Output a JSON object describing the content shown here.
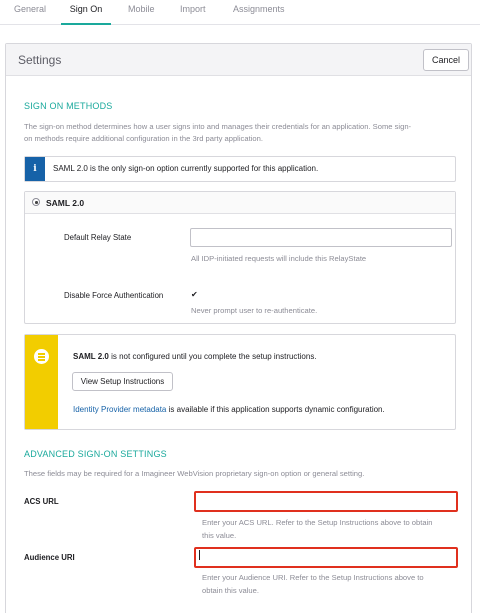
{
  "tabs": [
    {
      "label": "General",
      "active": false
    },
    {
      "label": "Sign On",
      "active": true
    },
    {
      "label": "Mobile",
      "active": false
    },
    {
      "label": "Import",
      "active": false
    },
    {
      "label": "Assignments",
      "active": false
    }
  ],
  "settings": {
    "title": "Settings",
    "cancel_label": "Cancel"
  },
  "sign_on_methods": {
    "title": "SIGN ON METHODS",
    "description_line1": "The sign-on method determines how a user signs into and manages their credentials for an application. Some sign-",
    "description_line2": "on methods require additional configuration in the 3rd party application.",
    "info_text": "SAML 2.0 is the only sign-on option currently supported for this application.",
    "saml_option": "SAML 2.0",
    "default_relay_state_label": "Default Relay State",
    "default_relay_state_value": "",
    "default_relay_state_hint": "All IDP-initiated requests will include this RelayState",
    "disable_force_auth_label": "Disable Force Authentication",
    "disable_force_auth_checked": true,
    "disable_force_auth_hint": "Never prompt user to re-authenticate."
  },
  "setup_notice": {
    "saml_bold": "SAML 2.0",
    "text": " is not configured until you complete the setup instructions.",
    "button_label": "View Setup Instructions",
    "idp_link": "Identity Provider metadata",
    "idp_text": " is available if this application supports dynamic configuration."
  },
  "advanced": {
    "title": "ADVANCED SIGN-ON SETTINGS",
    "description": "These fields may be required for a Imagineer WebVision proprietary sign-on option or general setting.",
    "acs_label": "ACS URL",
    "acs_value": "",
    "acs_hint_line1": "Enter your ACS URL. Refer to the Setup Instructions above to obtain",
    "acs_hint_line2": "this value.",
    "audience_label": "Audience URI",
    "audience_value": "",
    "audience_hint_line1": "Enter your Audience URI. Refer to the Setup Instructions above to",
    "audience_hint_line2": "obtain this value."
  },
  "colors": {
    "accent": "#1aa99c",
    "info_blue": "#1662a8",
    "warning_yellow": "#f2cd00",
    "highlight_red": "#e0301e"
  }
}
